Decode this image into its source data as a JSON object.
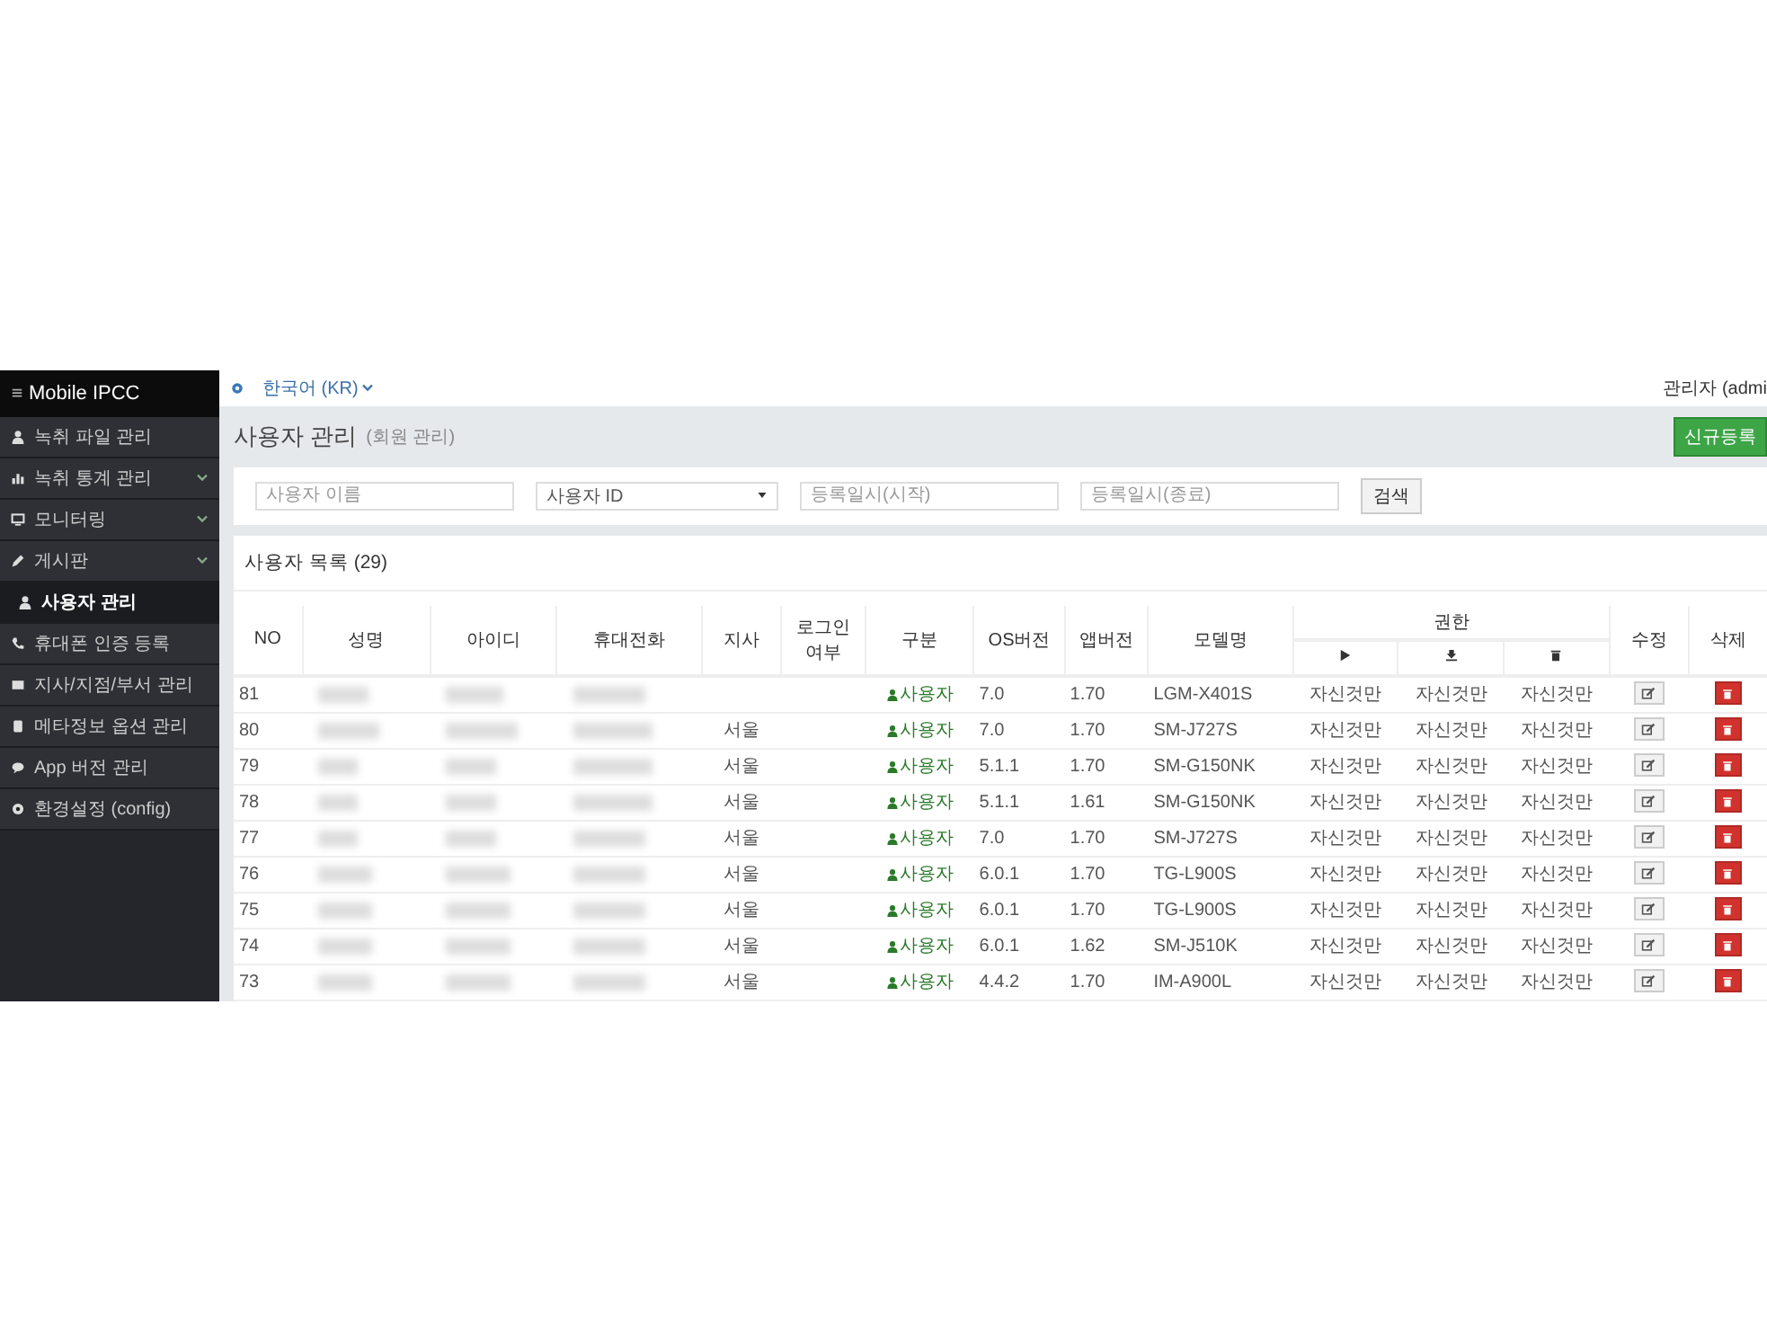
{
  "sidebar": {
    "logo": "Mobile IPCC",
    "items": [
      {
        "label": "녹취 파일 관리",
        "expandable": false,
        "selected": false
      },
      {
        "label": "녹취 통계 관리",
        "expandable": true,
        "selected": false
      },
      {
        "label": "모니터링",
        "expandable": true,
        "selected": false
      },
      {
        "label": "게시판",
        "expandable": true,
        "selected": false
      },
      {
        "label": "사용자 관리",
        "expandable": false,
        "selected": true
      },
      {
        "label": "휴대폰 인증 등록",
        "expandable": false,
        "selected": false
      },
      {
        "label": "지사/지점/부서 관리",
        "expandable": false,
        "selected": false
      },
      {
        "label": "메타정보 옵션 관리",
        "expandable": false,
        "selected": false
      },
      {
        "label": "App 버전 관리",
        "expandable": false,
        "selected": false
      },
      {
        "label": "환경설정 (config)",
        "expandable": false,
        "selected": false
      }
    ]
  },
  "topbar": {
    "language": "한국어 (KR)",
    "user": "관리자 (admi"
  },
  "page": {
    "title": "사용자 관리",
    "subtitle": "(회원 관리)",
    "new_button": "신규등록"
  },
  "filters": {
    "name": {
      "placeholder": "사용자 이름"
    },
    "id_select": {
      "value": "사용자 ID"
    },
    "start": {
      "placeholder": "등록일시(시작)"
    },
    "end": {
      "placeholder": "등록일시(종료)"
    },
    "search_button": "검색"
  },
  "list": {
    "title": "사용자 목록 (29)",
    "columns": [
      "NO",
      "성명",
      "아이디",
      "휴대전화",
      "지사",
      "로그인\n여부",
      "구분",
      "OS버전",
      "앱버전",
      "모델명"
    ],
    "perm_group": "권한",
    "edit_column": "수정",
    "delete_column": "삭제",
    "rows": [
      {
        "no": "81",
        "branch": "",
        "type": "사용자",
        "os": "7.0",
        "app": "1.70",
        "model": "LGM-X401S",
        "perms": [
          "자신것만",
          "자신것만",
          "자신것만"
        ]
      },
      {
        "no": "80",
        "branch": "서울",
        "type": "사용자",
        "os": "7.0",
        "app": "1.70",
        "model": "SM-J727S",
        "perms": [
          "자신것만",
          "자신것만",
          "자신것만"
        ]
      },
      {
        "no": "79",
        "branch": "서울",
        "type": "사용자",
        "os": "5.1.1",
        "app": "1.70",
        "model": "SM-G150NK",
        "perms": [
          "자신것만",
          "자신것만",
          "자신것만"
        ]
      },
      {
        "no": "78",
        "branch": "서울",
        "type": "사용자",
        "os": "5.1.1",
        "app": "1.61",
        "model": "SM-G150NK",
        "perms": [
          "자신것만",
          "자신것만",
          "자신것만"
        ]
      },
      {
        "no": "77",
        "branch": "서울",
        "type": "사용자",
        "os": "7.0",
        "app": "1.70",
        "model": "SM-J727S",
        "perms": [
          "자신것만",
          "자신것만",
          "자신것만"
        ]
      },
      {
        "no": "76",
        "branch": "서울",
        "type": "사용자",
        "os": "6.0.1",
        "app": "1.70",
        "model": "TG-L900S",
        "perms": [
          "자신것만",
          "자신것만",
          "자신것만"
        ]
      },
      {
        "no": "75",
        "branch": "서울",
        "type": "사용자",
        "os": "6.0.1",
        "app": "1.70",
        "model": "TG-L900S",
        "perms": [
          "자신것만",
          "자신것만",
          "자신것만"
        ]
      },
      {
        "no": "74",
        "branch": "서울",
        "type": "사용자",
        "os": "6.0.1",
        "app": "1.62",
        "model": "SM-J510K",
        "perms": [
          "자신것만",
          "자신것만",
          "자신것만"
        ]
      },
      {
        "no": "73",
        "branch": "서울",
        "type": "사용자",
        "os": "4.4.2",
        "app": "1.70",
        "model": "IM-A900L",
        "perms": [
          "자신것만",
          "자신것만",
          "자신것만"
        ]
      }
    ]
  }
}
